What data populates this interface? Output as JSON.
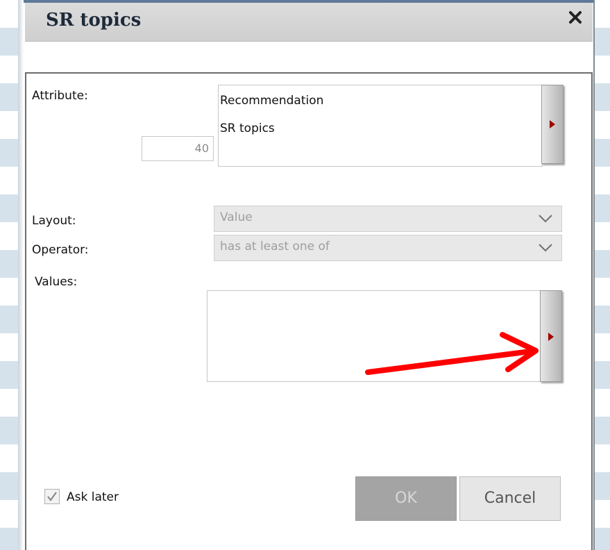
{
  "dialog": {
    "title": "SR topics"
  },
  "form": {
    "attribute_label": "Attribute:",
    "attribute_items": [
      "Recommendation",
      "SR topics"
    ],
    "count_value": "40",
    "layout_label": "Layout:",
    "layout_value": "Value",
    "operator_label": "Operator:",
    "operator_value": "has at least one of",
    "values_label": "Values:"
  },
  "footer": {
    "ask_later_label": "Ask later",
    "ask_later_checked": true,
    "ok_label": "OK",
    "cancel_label": "Cancel"
  },
  "colors": {
    "annotation_arrow": "#ff0000",
    "expand_triangle": "#a00000"
  },
  "icons": {
    "close": "close-icon",
    "expand": "triangle-right-icon",
    "dropdown": "chevron-down-icon",
    "check": "checkmark-icon"
  }
}
